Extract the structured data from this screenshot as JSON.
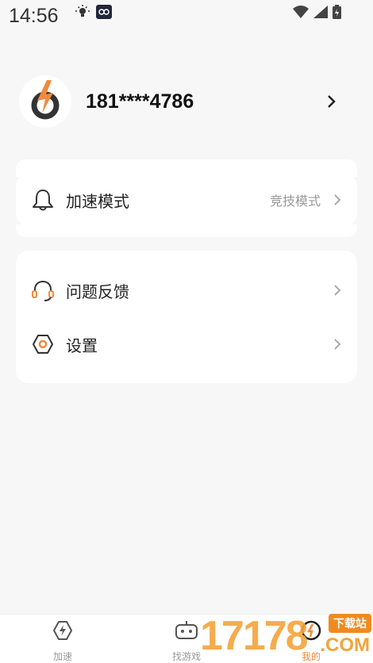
{
  "status_bar": {
    "time": "14:56",
    "left_icons": [
      "bulb-icon",
      "app-notification-icon"
    ],
    "right_icons": [
      "wifi-icon",
      "signal-icon",
      "battery-charging-icon"
    ]
  },
  "profile": {
    "avatar_icon": "app-logo-icon",
    "phone": "181****4786"
  },
  "mode_row": {
    "label": "加速模式",
    "value": "竞技模式"
  },
  "menu": [
    {
      "label": "问题反馈",
      "icon": "headset-icon"
    },
    {
      "label": "设置",
      "icon": "settings-icon"
    }
  ],
  "tabbar": {
    "tabs": [
      {
        "label": "加速",
        "icon": "boost-icon",
        "active": false
      },
      {
        "label": "找游戏",
        "icon": "gamepad-icon",
        "active": false
      },
      {
        "label": "我的",
        "icon": "profile-icon",
        "active": true
      }
    ]
  },
  "watermark": {
    "number": "17178",
    "badge": "下载站",
    "domain": ".COM"
  },
  "colors": {
    "accent": "#f08a3c",
    "background": "#f7f7f7",
    "card": "#ffffff",
    "muted_text": "#999999"
  }
}
